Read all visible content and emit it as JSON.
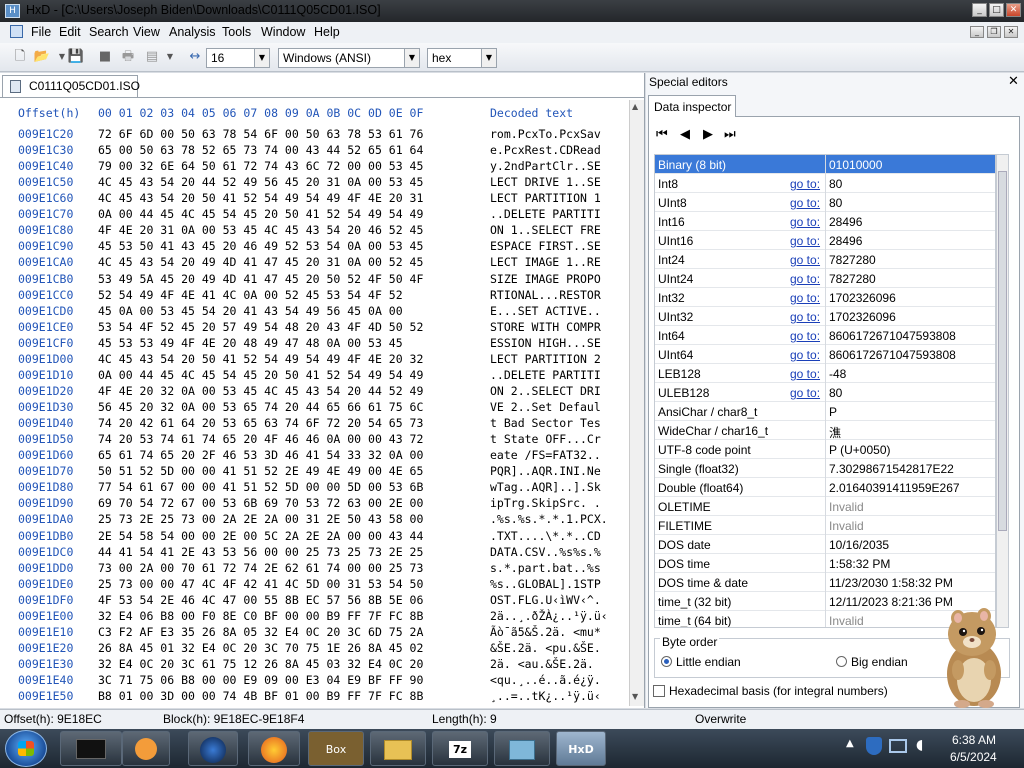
{
  "window": {
    "title": "HxD - [C:\\Users\\Joseph Biden\\Downloads\\C0111Q05CD01.ISO]"
  },
  "menu": [
    "File",
    "Edit",
    "Search",
    "View",
    "Analysis",
    "Tools",
    "Window",
    "Help"
  ],
  "toolbar": {
    "bytes_per_row": "16",
    "charset": "Windows (ANSI)",
    "offset_base": "hex"
  },
  "document": {
    "tab": "C0111Q05CD01.ISO"
  },
  "hex": {
    "header_offset": "Offset(h)",
    "header_cols": "00 01 02 03 04 05 06 07 08 09 0A 0B 0C 0D 0E 0F",
    "header_decoded": "Decoded text",
    "rows": [
      {
        "off": "009E1C20",
        "hex": "72 6F 6D 00 50 63 78 54 6F 00 50 63 78 53 61 76",
        "txt": "rom.PcxTo.PcxSav"
      },
      {
        "off": "009E1C30",
        "hex": "65 00 50 63 78 52 65 73 74 00 43 44 52 65 61 64",
        "txt": "e.PcxRest.CDRead"
      },
      {
        "off": "009E1C40",
        "hex": "79 00 32 6E 64 50 61 72 74 43 6C 72 00 00 53 45",
        "txt": "y.2ndPartClr..SE"
      },
      {
        "off": "009E1C50",
        "hex": "4C 45 43 54 20 44 52 49 56 45 20 31 0A 00 53 45",
        "txt": "LECT DRIVE 1..SE"
      },
      {
        "off": "009E1C60",
        "hex": "4C 45 43 54 20 50 41 52 54 49 54 49 4F 4E 20 31",
        "txt": "LECT PARTITION 1"
      },
      {
        "off": "009E1C70",
        "hex": "0A 00 44 45 4C 45 54 45 20 50 41 52 54 49 54 49",
        "txt": "..DELETE PARTITI"
      },
      {
        "off": "009E1C80",
        "hex": "4F 4E 20 31 0A 00 53 45 4C 45 43 54 20 46 52 45",
        "txt": "ON 1..SELECT FRE"
      },
      {
        "off": "009E1C90",
        "hex": "45 53 50 41 43 45 20 46 49 52 53 54 0A 00 53 45",
        "txt": "ESPACE FIRST..SE"
      },
      {
        "off": "009E1CA0",
        "hex": "4C 45 43 54 20 49 4D 41 47 45 20 31 0A 00 52 45",
        "txt": "LECT IMAGE 1..RE"
      },
      {
        "off": "009E1CB0",
        "hex": "53 49 5A 45 20 49 4D 41 47 45 20 50 52 4F 50 4F",
        "txt": "SIZE IMAGE PROPO"
      },
      {
        "off": "009E1CC0",
        "hex": "52 54 49 4F 4E 41 4C 0A 00 52 45 53 54 4F 52",
        "txt": "RTIONAL...RESTOR"
      },
      {
        "off": "009E1CD0",
        "hex": "45 0A 00 53 45 54 20 41 43 54 49 56 45 0A 00",
        "txt": "E...SET ACTIVE.."
      },
      {
        "off": "009E1CE0",
        "hex": "53 54 4F 52 45 20 57 49 54 48 20 43 4F 4D 50 52",
        "txt": "STORE WITH COMPR"
      },
      {
        "off": "009E1CF0",
        "hex": "45 53 53 49 4F 4E 20 48 49 47 48 0A 00 53 45",
        "txt": "ESSION HIGH...SE"
      },
      {
        "off": "009E1D00",
        "hex": "4C 45 43 54 20 50 41 52 54 49 54 49 4F 4E 20 32",
        "txt": "LECT PARTITION 2"
      },
      {
        "off": "009E1D10",
        "hex": "0A 00 44 45 4C 45 54 45 20 50 41 52 54 49 54 49",
        "txt": "..DELETE PARTITI"
      },
      {
        "off": "009E1D20",
        "hex": "4F 4E 20 32 0A 00 53 45 4C 45 43 54 20 44 52 49",
        "txt": "ON 2..SELECT DRI"
      },
      {
        "off": "009E1D30",
        "hex": "56 45 20 32 0A 00 53 65 74 20 44 65 66 61 75 6C",
        "txt": "VE 2..Set Defaul"
      },
      {
        "off": "009E1D40",
        "hex": "74 20 42 61 64 20 53 65 63 74 6F 72 20 54 65 73",
        "txt": "t Bad Sector Tes"
      },
      {
        "off": "009E1D50",
        "hex": "74 20 53 74 61 74 65 20 4F 46 46 0A 00 00 43 72",
        "txt": "t State OFF...Cr"
      },
      {
        "off": "009E1D60",
        "hex": "65 61 74 65 20 2F 46 53 3D 46 41 54 33 32 0A 00",
        "txt": "eate /FS=FAT32.."
      },
      {
        "off": "009E1D70",
        "hex": "50 51 52 5D 00 00 41 51 52 2E 49 4E 49 00 4E 65",
        "txt": "PQR]..AQR.INI.Ne"
      },
      {
        "off": "009E1D80",
        "hex": "77 54 61 67 00 00 41 51 52 5D 00 00 5D 00 53 6B",
        "txt": "wTag..AQR]..].Sk"
      },
      {
        "off": "009E1D90",
        "hex": "69 70 54 72 67 00 53 6B 69 70 53 72 63 00 2E 00",
        "txt": "ipTrg.SkipSrc. ."
      },
      {
        "off": "009E1DA0",
        "hex": "25 73 2E 25 73 00 2A 2E 2A 00 31 2E 50 43 58 00",
        "txt": ".%s.%s.*.*.1.PCX."
      },
      {
        "off": "009E1DB0",
        "hex": "2E 54 58 54 00 00 2E 00 5C 2A 2E 2A 00 00 43 44",
        "txt": ".TXT....\\*.*..CD"
      },
      {
        "off": "009E1DC0",
        "hex": "44 41 54 41 2E 43 53 56 00 00 25 73 25 73 2E 25",
        "txt": "DATA.CSV..%s%s.%"
      },
      {
        "off": "009E1DD0",
        "hex": "73 00 2A 00 70 61 72 74 2E 62 61 74 00 00 25 73",
        "txt": "s.*.part.bat..%s"
      },
      {
        "off": "009E1DE0",
        "hex": "25 73 00 00 47 4C 4F 42 41 4C 5D 00 31 53 54 50",
        "txt": "%s..GLOBAL].1STP"
      },
      {
        "off": "009E1DF0",
        "hex": "4F 53 54 2E 46 4C 47 00 55 8B EC 57 56 8B 5E 06",
        "txt": "OST.FLG.U‹ìWV‹^."
      },
      {
        "off": "009E1E00",
        "hex": "32 E4 06 B8 00 F0 8E C0 BF 00 00 B9 FF 7F FC 8B",
        "txt": "2ä..¸.ðŽÀ¿..¹ÿ.ü‹"
      },
      {
        "off": "009E1E10",
        "hex": "C3 F2 AF E3 35 26 8A 05 32 E4 0C 20 3C 6D 75 2A",
        "txt": "Ãò¯ã5&Š.2ä. <mu*"
      },
      {
        "off": "009E1E20",
        "hex": "26 8A 45 01 32 E4 0C 20 3C 70 75 1E 26 8A 45 02",
        "txt": "&ŠE.2ä. <pu.&ŠE."
      },
      {
        "off": "009E1E30",
        "hex": "32 E4 0C 20 3C 61 75 12 26 8A 45 03 32 E4 0C 20",
        "txt": "2ä. <au.&ŠE.2ä. "
      },
      {
        "off": "009E1E40",
        "hex": "3C 71 75 06 B8 00 00 E9 09 00 E3 04 E9 BF FF 90",
        "txt": "<qu.¸..é..ã.é¿ÿ."
      },
      {
        "off": "009E1E50",
        "hex": "B8 01 00 3D 00 00 74 4B BF 01 00 B9 FF 7F FC 8B",
        "txt": "¸..=..tK¿..¹ÿ.ü‹"
      }
    ]
  },
  "status": {
    "offset": "Offset(h): 9E18EC",
    "block": "Block(h): 9E18EC-9E18F4",
    "length": "Length(h): 9",
    "mode": "Overwrite"
  },
  "side": {
    "title": "Special editors",
    "tab": "Data inspector",
    "goto_label": "go to:",
    "rows": [
      {
        "name": "Binary (8 bit)",
        "goto": false,
        "value": "01010000",
        "selected": true
      },
      {
        "name": "Int8",
        "goto": true,
        "value": "80"
      },
      {
        "name": "UInt8",
        "goto": true,
        "value": "80"
      },
      {
        "name": "Int16",
        "goto": true,
        "value": "28496"
      },
      {
        "name": "UInt16",
        "goto": true,
        "value": "28496"
      },
      {
        "name": "Int24",
        "goto": true,
        "value": "7827280"
      },
      {
        "name": "UInt24",
        "goto": true,
        "value": "7827280"
      },
      {
        "name": "Int32",
        "goto": true,
        "value": "1702326096"
      },
      {
        "name": "UInt32",
        "goto": true,
        "value": "1702326096"
      },
      {
        "name": "Int64",
        "goto": true,
        "value": "8606172671047593808"
      },
      {
        "name": "UInt64",
        "goto": true,
        "value": "8606172671047593808"
      },
      {
        "name": "LEB128",
        "goto": true,
        "value": "-48"
      },
      {
        "name": "ULEB128",
        "goto": true,
        "value": "80"
      },
      {
        "name": "AnsiChar / char8_t",
        "goto": false,
        "value": "P"
      },
      {
        "name": "WideChar / char16_t",
        "goto": false,
        "value": "潐"
      },
      {
        "name": "UTF-8 code point",
        "goto": false,
        "value": "P (U+0050)"
      },
      {
        "name": "Single (float32)",
        "goto": false,
        "value": "7.30298671542817E22"
      },
      {
        "name": "Double (float64)",
        "goto": false,
        "value": "2.01640391411959E267"
      },
      {
        "name": "OLETIME",
        "goto": false,
        "value": "Invalid",
        "invalid": true
      },
      {
        "name": "FILETIME",
        "goto": false,
        "value": "Invalid",
        "invalid": true
      },
      {
        "name": "DOS date",
        "goto": false,
        "value": "10/16/2035"
      },
      {
        "name": "DOS time",
        "goto": false,
        "value": "1:58:32 PM"
      },
      {
        "name": "DOS time & date",
        "goto": false,
        "value": "11/23/2030 1:58:32 PM"
      },
      {
        "name": "time_t (32 bit)",
        "goto": false,
        "value": "12/11/2023 8:21:36 PM"
      },
      {
        "name": "time_t (64 bit)",
        "goto": false,
        "value": "Invalid",
        "invalid": true
      }
    ],
    "byte_order_label": "Byte order",
    "little_endian": "Little endian",
    "big_endian": "Big endian",
    "hex_basis": "Hexadecimal basis (for integral numbers)"
  },
  "taskbar": {
    "time": "6:38 AM",
    "date": "6/5/2024",
    "items": [
      "",
      "",
      "",
      "",
      "Box",
      "",
      "7z",
      "",
      "HxD"
    ]
  }
}
